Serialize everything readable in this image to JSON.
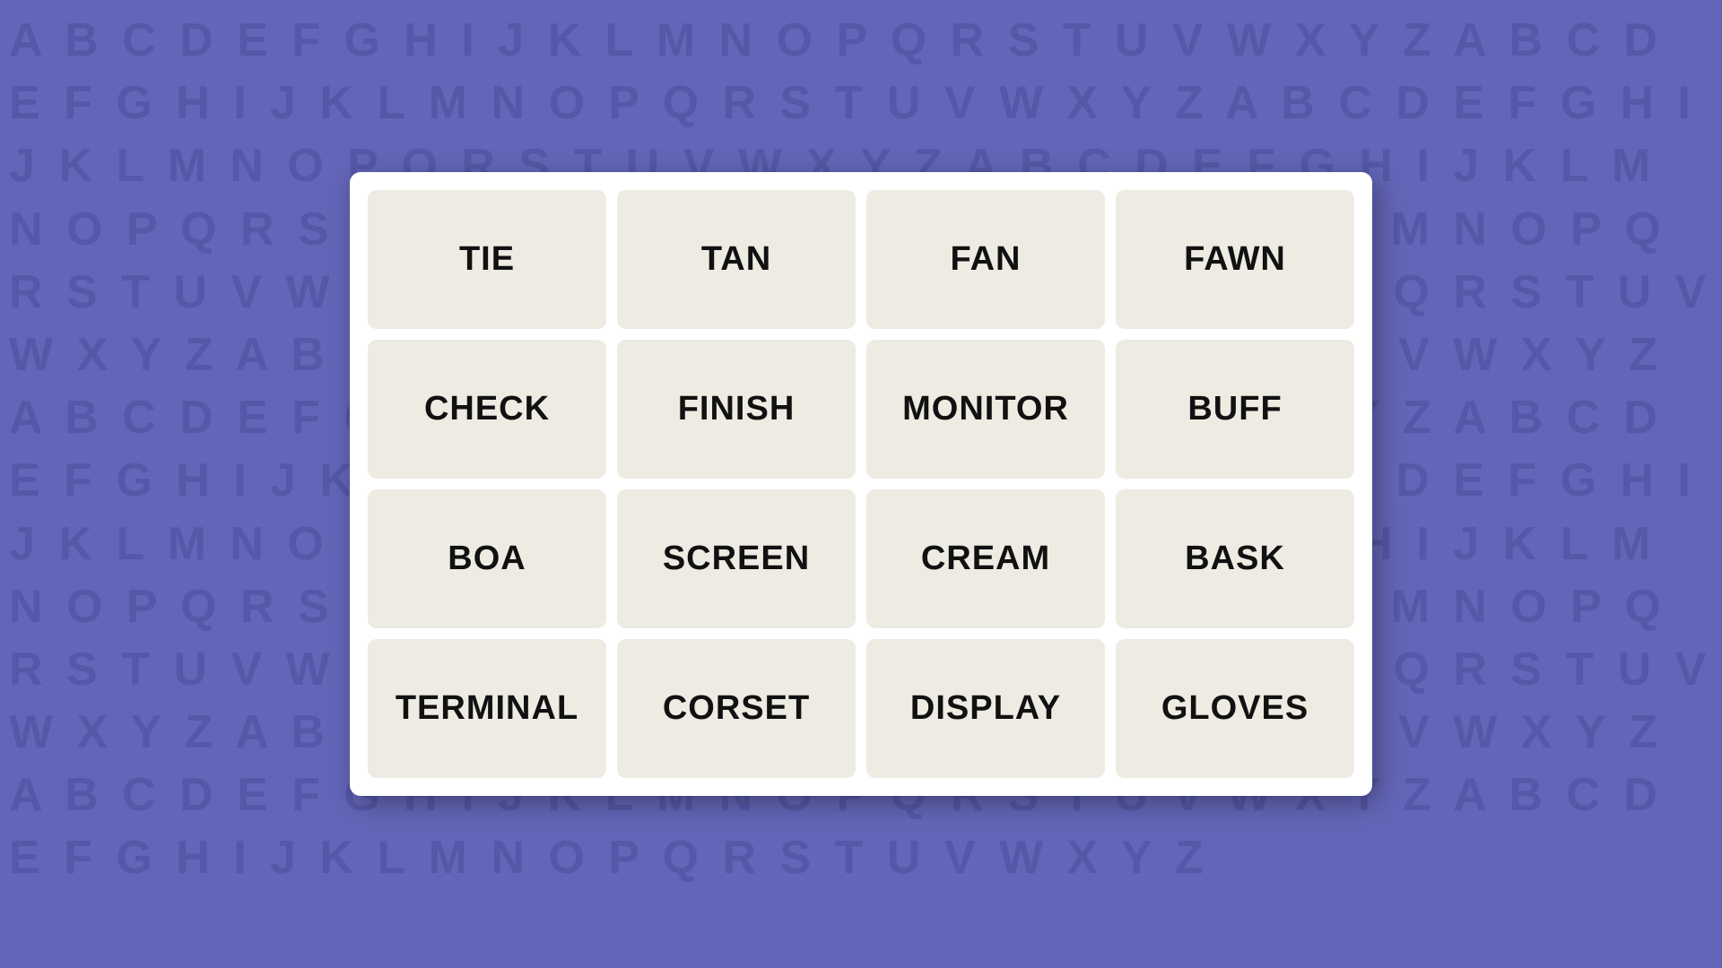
{
  "background": {
    "color": "#6366b8",
    "letters_text": "A B C D E F G H I J K L M N O P Q R S T U V W X Y Z A B C D E F G H I J K L M N O P Q R S T U V W X Y Z A B C D E F G H I J K L M N O P Q R S T U V W X Y Z A B C D E F G H I J K L M N O P Q R S T U V W X Y Z A B C D E F G H I J K L M N O P Q R S T U V W X Y Z A B C D E F G H I J K L M N O P Q R S T U V W X Y Z A B C D E F G H I J K L M N O P Q R S T U V W X Y Z A B C D E F G H I J K L M N O P Q R S T U V W X Y Z A B C D E F G H I J K L M N O P Q R S T U V W X Y Z A B C D E F G H I J K L M N O P Q R S T U V W X Y Z A B C D E F G H I J K L M N O P Q R S T U V W X Y Z A B C D E F G H I J K L M N O P Q R S T U V W X Y Z A B C D E F G H I J K L M N O P Q R S T U V W X Y Z A B C D E F G H I J K L M N O P Q R S T U V W X Y Z A B C D E F G H I J K L M N O P Q R S T U V W X Y Z A B C D E F G H I J K L M N O P Q R S T U V W X Y Z"
  },
  "grid": {
    "cells": [
      {
        "id": "tie",
        "label": "TIE"
      },
      {
        "id": "tan",
        "label": "TAN"
      },
      {
        "id": "fan",
        "label": "FAN"
      },
      {
        "id": "fawn",
        "label": "FAWN"
      },
      {
        "id": "check",
        "label": "CHECK"
      },
      {
        "id": "finish",
        "label": "FINISH"
      },
      {
        "id": "monitor",
        "label": "MONITOR"
      },
      {
        "id": "buff",
        "label": "BUFF"
      },
      {
        "id": "boa",
        "label": "BOA"
      },
      {
        "id": "screen",
        "label": "SCREEN"
      },
      {
        "id": "cream",
        "label": "CREAM"
      },
      {
        "id": "bask",
        "label": "BASK"
      },
      {
        "id": "terminal",
        "label": "TERMINAL"
      },
      {
        "id": "corset",
        "label": "CORSET"
      },
      {
        "id": "display",
        "label": "DISPLAY"
      },
      {
        "id": "gloves",
        "label": "GLOVES"
      }
    ]
  }
}
